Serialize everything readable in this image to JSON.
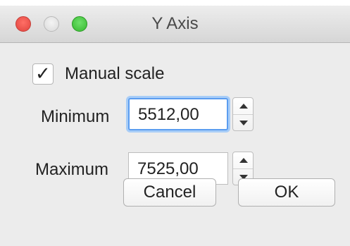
{
  "window": {
    "title": "Y Axis"
  },
  "controls": {
    "manual_scale": {
      "label": "Manual scale",
      "checked": true
    },
    "minimum": {
      "label": "Minimum",
      "value": "5512,00"
    },
    "maximum": {
      "label": "Maximum",
      "value": "7525,00"
    }
  },
  "buttons": {
    "cancel": "Cancel",
    "ok": "OK"
  },
  "colors": {
    "close": "#ff5f57",
    "zoom": "#28c840",
    "focus": "#5b9df0"
  },
  "icons": {
    "close": "close-icon",
    "minimize": "minimize-icon",
    "zoom": "zoom-icon",
    "check": "checkmark-icon",
    "up": "arrow-up-icon",
    "down": "arrow-down-icon"
  }
}
